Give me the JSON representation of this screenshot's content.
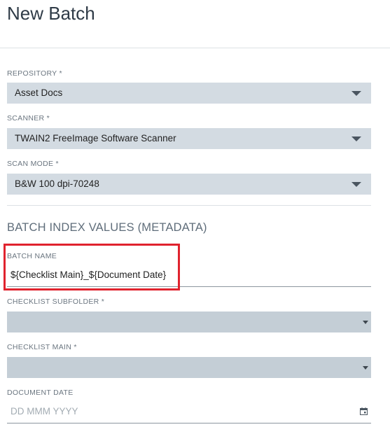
{
  "page": {
    "title": "New Batch"
  },
  "form": {
    "repository": {
      "label": "REPOSITORY *",
      "value": "Asset Docs"
    },
    "scanner": {
      "label": "SCANNER *",
      "value": "TWAIN2 FreeImage Software Scanner"
    },
    "scan_mode": {
      "label": "SCAN MODE *",
      "value": "B&W 100 dpi-70248"
    }
  },
  "metadata": {
    "section_title": "BATCH INDEX VALUES (METADATA)",
    "batch_name": {
      "label": "BATCH NAME",
      "value": "${Checklist Main}_${Document Date}"
    },
    "checklist_subfolder": {
      "label": "CHECKLIST SUBFOLDER *",
      "value": ""
    },
    "checklist_main": {
      "label": "CHECKLIST MAIN *",
      "value": ""
    },
    "document_date": {
      "label": "DOCUMENT DATE",
      "placeholder": "DD MMM YYYY"
    }
  },
  "colors": {
    "select_bg": "#d3dbe2",
    "highlight": "#e0232e",
    "title": "#2f3b47"
  }
}
